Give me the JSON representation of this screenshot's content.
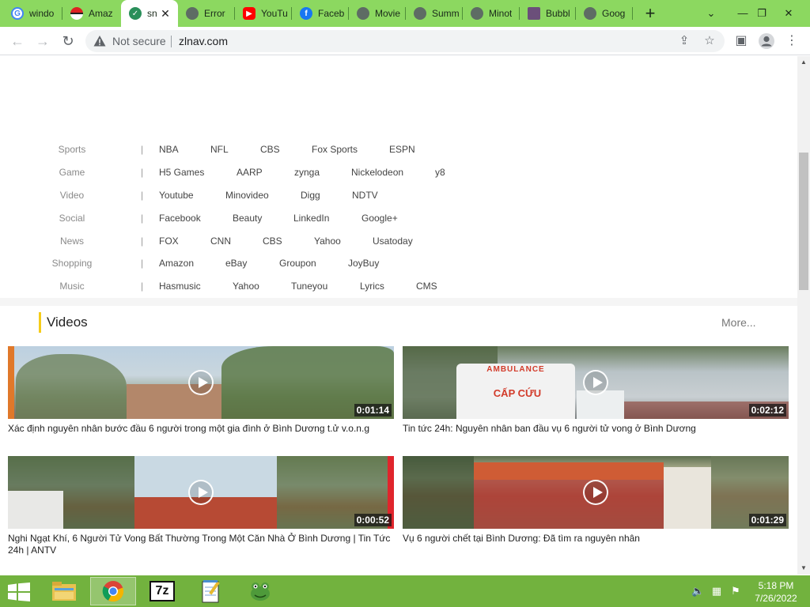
{
  "browser": {
    "tabs": [
      {
        "label": "windo",
        "icon": "google-icon"
      },
      {
        "label": "Amaz",
        "icon": "pokeball-icon"
      },
      {
        "label": "sn",
        "icon": "shield-icon",
        "active": true
      },
      {
        "label": "Error",
        "icon": "globe-icon"
      },
      {
        "label": "YouTu",
        "icon": "youtube-icon"
      },
      {
        "label": "Faceb",
        "icon": "facebook-icon"
      },
      {
        "label": "Movie",
        "icon": "globe-icon"
      },
      {
        "label": "Summ",
        "icon": "globe-icon"
      },
      {
        "label": "Minot",
        "icon": "globe-icon"
      },
      {
        "label": "Bubbl",
        "icon": "bubble-icon"
      },
      {
        "label": "Goog",
        "icon": "globe-icon"
      }
    ],
    "new_tab_symbol": "+",
    "security_label": "Not secure",
    "url": "zlnav.com",
    "theme_color": "#8cd860"
  },
  "categories": [
    {
      "name": "Sports",
      "links": [
        "NBA",
        "NFL",
        "CBS",
        "Fox Sports",
        "ESPN"
      ]
    },
    {
      "name": "Game",
      "links": [
        "H5 Games",
        "AARP",
        "zynga",
        "Nickelodeon",
        "y8"
      ]
    },
    {
      "name": "Video",
      "links": [
        "Youtube",
        "Minovideo",
        "Digg",
        "NDTV"
      ]
    },
    {
      "name": "Social",
      "links": [
        "Facebook",
        "Beauty",
        "LinkedIn",
        "Google+"
      ]
    },
    {
      "name": "News",
      "links": [
        "FOX",
        "CNN",
        "CBS",
        "Yahoo",
        "Usatoday"
      ]
    },
    {
      "name": "Shopping",
      "links": [
        "Amazon",
        "eBay",
        "Groupon",
        "JoyBuy"
      ]
    },
    {
      "name": "Music",
      "links": [
        "Hasmusic",
        "Yahoo",
        "Tuneyou",
        "Lyrics",
        "CMS"
      ]
    }
  ],
  "videos": {
    "title": "Videos",
    "more_label": "More...",
    "accent_color": "#f5cc1a",
    "items": [
      {
        "duration": "0:01:14",
        "caption": "Xác định nguyên nhân bước đầu 6 người trong một gia đình ở Bình Dương t.ử v.o.n.g"
      },
      {
        "duration": "0:02:12",
        "caption": "Tin tức 24h: Nguyên nhân ban đầu vụ 6 người tử vong ở Bình Dương"
      },
      {
        "duration": "0:00:52",
        "caption": "Nghi Ngạt Khí, 6 Người Tử Vong Bất Thường Trong Một Căn Nhà Ở Bình Dương | Tin Tức 24h | ANTV"
      },
      {
        "duration": "0:01:29",
        "caption": "Vụ 6 người chết tại Bình Dương: Đã tìm ra nguyên nhân"
      }
    ],
    "thumb_texts": [
      "AMBULANCE",
      "CẤP CỨU"
    ]
  },
  "taskbar": {
    "apps": [
      "file-explorer-icon",
      "chrome-icon",
      "7zip-icon",
      "notepad-icon",
      "frog-app-icon"
    ],
    "seven_zip_label": "7z",
    "time": "5:18 PM",
    "date": "7/26/2022"
  }
}
